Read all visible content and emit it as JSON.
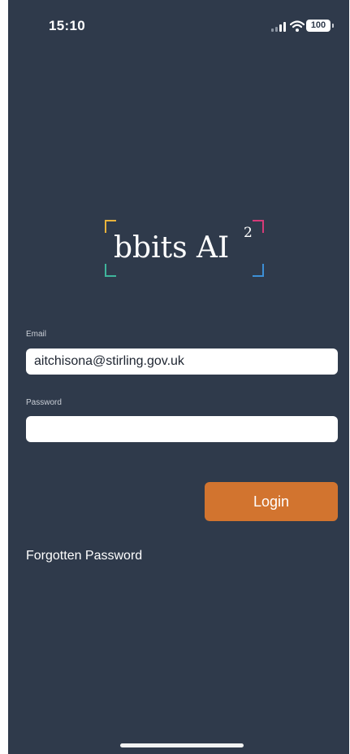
{
  "status_bar": {
    "time": "15:10",
    "battery": "100"
  },
  "logo": {
    "text": "bbits AI",
    "superscript": "2"
  },
  "form": {
    "email_label": "Email",
    "email_value": "aitchisona@stirling.gov.uk",
    "password_label": "Password",
    "password_value": ""
  },
  "actions": {
    "login_label": "Login",
    "forgot_label": "Forgotten Password"
  },
  "colors": {
    "background": "#2f3a4b",
    "login_button": "#d2742f"
  }
}
